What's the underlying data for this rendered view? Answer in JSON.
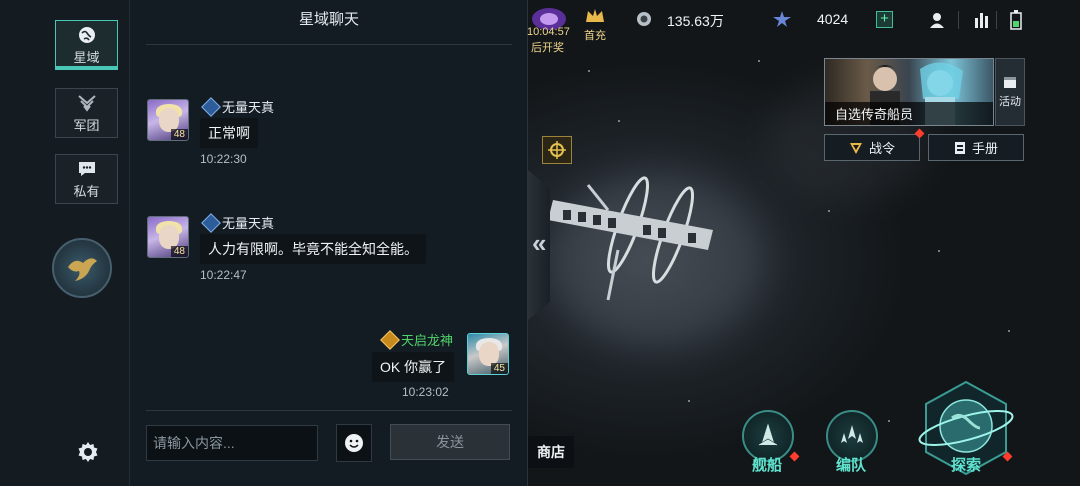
{
  "sidebar": {
    "tabs": [
      {
        "label": "星域",
        "icon": "globe-icon",
        "active": true
      },
      {
        "label": "军团",
        "icon": "legion-icon",
        "active": false
      },
      {
        "label": "私有",
        "icon": "message-icon",
        "active": false
      }
    ]
  },
  "chat": {
    "title": "星域聊天",
    "messages": [
      {
        "sender": "无量天真",
        "level": "48",
        "text": "正常啊",
        "time": "10:22:30",
        "self": false
      },
      {
        "sender": "无量天真",
        "level": "48",
        "text": "人力有限啊。毕竟不能全知全能。",
        "time": "10:22:47",
        "self": false
      },
      {
        "sender": "天启龙神",
        "level": "45",
        "text": "OK 你赢了",
        "time": "10:23:02",
        "self": true
      }
    ],
    "input_placeholder": "请输入内容...",
    "send_label": "发送"
  },
  "hud": {
    "timer": "10:04:57",
    "timer_sub": "后开奖",
    "first_charge": "首充",
    "currency": "135.63万",
    "energy": "4024"
  },
  "right_panel": {
    "crew_label": "自选传奇船员",
    "activity_label": "活动",
    "battle_order_label": "战令",
    "handbook_label": "手册"
  },
  "bottom_nav": {
    "shop": "商店",
    "ships": "舰船",
    "fleet": "编队",
    "explore": "探索"
  },
  "colors": {
    "accent": "#49c7b7",
    "self_name": "#4fd36a",
    "alert": "#ff3d2e"
  }
}
